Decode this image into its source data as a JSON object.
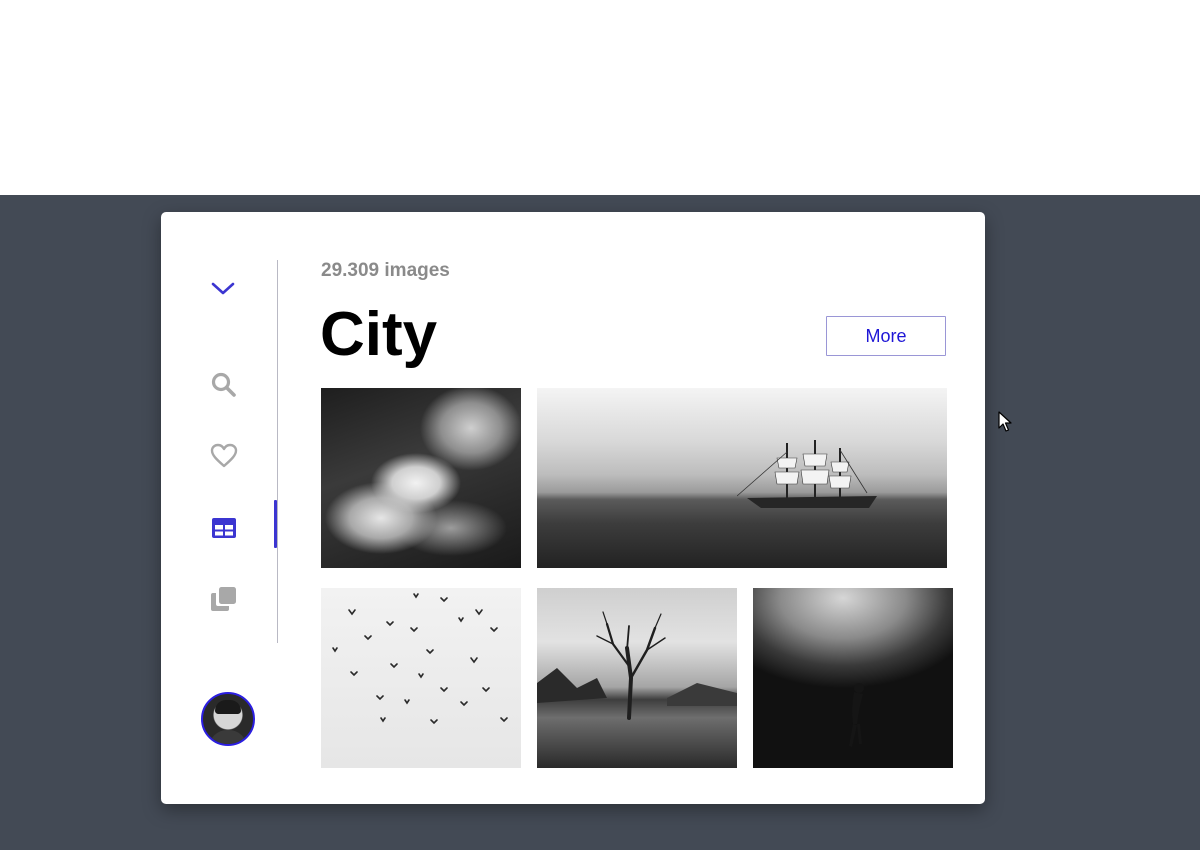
{
  "gallery": {
    "count_label": "29.309 images",
    "title": "City",
    "more_label": "More",
    "photos": [
      {
        "subject": "clouds"
      },
      {
        "subject": "sailing ship"
      },
      {
        "subject": "birds"
      },
      {
        "subject": "tree in lake"
      },
      {
        "subject": "underwater diver"
      }
    ]
  },
  "sidebar": {
    "items": [
      {
        "icon": "chevron-down-icon",
        "active": false
      },
      {
        "icon": "search-icon",
        "active": false
      },
      {
        "icon": "heart-icon",
        "active": false
      },
      {
        "icon": "grid-icon",
        "active": true
      },
      {
        "icon": "copies-icon",
        "active": false
      }
    ]
  },
  "colors": {
    "accent": "#3b35d1",
    "background": "#434a55",
    "icon_inactive": "#a8a8a8"
  }
}
